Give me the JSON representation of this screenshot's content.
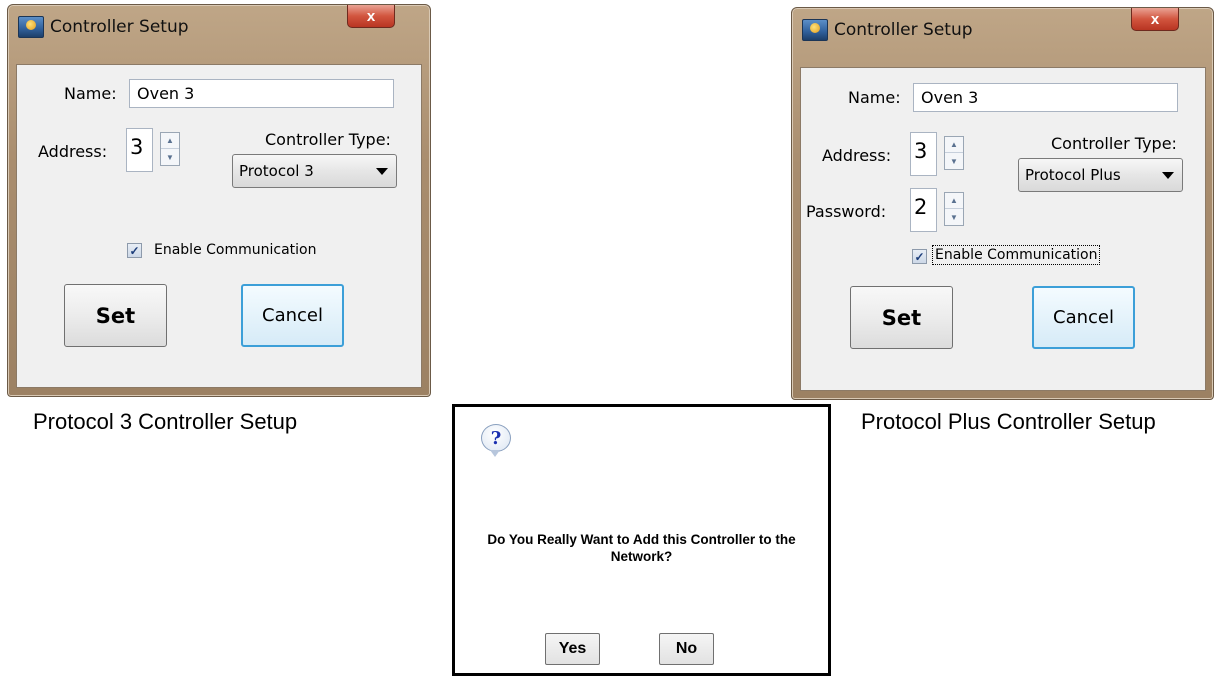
{
  "dialog_left": {
    "title": "Controller Setup",
    "close_glyph": "x",
    "name_label": "Name:",
    "name_value": "Oven 3",
    "address_label": "Address:",
    "address_value": "3",
    "controller_type_label": "Controller Type:",
    "controller_type_value": "Protocol 3",
    "enable_label": "Enable Communication",
    "enable_checked": true,
    "set_label": "Set",
    "cancel_label": "Cancel"
  },
  "dialog_right": {
    "title": "Controller Setup",
    "close_glyph": "x",
    "name_label": "Name:",
    "name_value": "Oven 3",
    "address_label": "Address:",
    "address_value": "3",
    "password_label": "Password:",
    "password_value": "2",
    "controller_type_label": "Controller Type:",
    "controller_type_value": "Protocol Plus",
    "enable_label": "Enable Communication",
    "enable_checked": true,
    "set_label": "Set",
    "cancel_label": "Cancel"
  },
  "captions": {
    "left": "Protocol 3 Controller Setup",
    "right": "Protocol Plus Controller Setup"
  },
  "confirm": {
    "icon_glyph": "?",
    "message": "Do You Really Want to Add this Controller to the Network?",
    "yes_label": "Yes",
    "no_label": "No"
  },
  "icons": {
    "app": "controller-setup-app-icon",
    "close": "close-icon",
    "question": "question-icon",
    "spin_up": "spin-up-icon",
    "spin_down": "spin-down-icon",
    "dropdown": "chevron-down-icon",
    "check": "checkmark-icon"
  }
}
